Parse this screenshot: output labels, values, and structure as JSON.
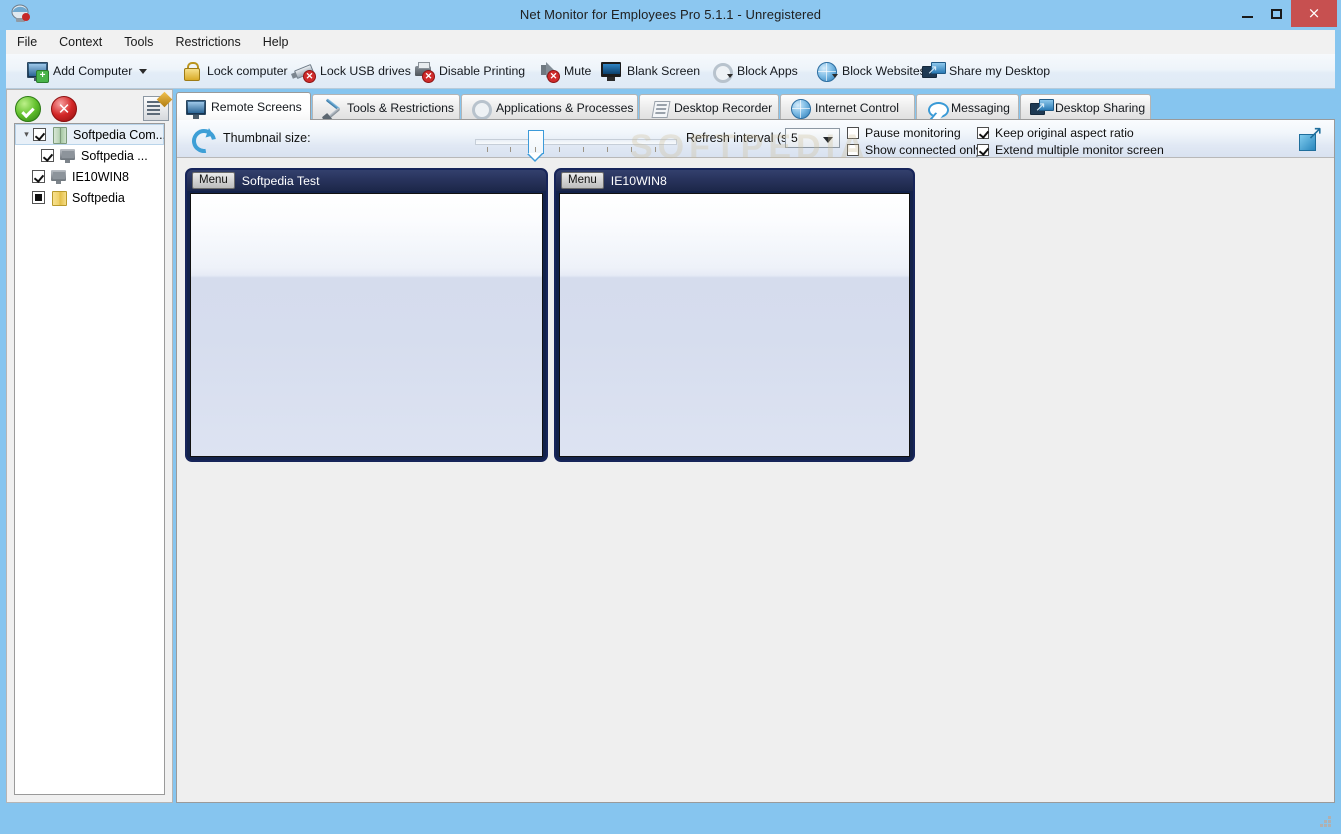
{
  "window": {
    "title": "Net Monitor for Employees Pro 5.1.1 - Unregistered",
    "app_icon": "net-monitor-icon",
    "minimize_label": "",
    "maximize_label": "",
    "close_label": "×",
    "accent_titlebar": "#8cc7f0",
    "accent_close": "#c75050"
  },
  "menubar": {
    "items": [
      {
        "label": "File"
      },
      {
        "label": "Context"
      },
      {
        "label": "Tools"
      },
      {
        "label": "Restrictions"
      },
      {
        "label": "Help"
      }
    ]
  },
  "toolbar": {
    "items": [
      {
        "label": "Add Computer",
        "icon": "monitor-plus-icon",
        "has_dropdown": true
      },
      {
        "label": "Lock computer",
        "icon": "padlock-icon",
        "has_dropdown": false
      },
      {
        "label": "Lock USB drives",
        "icon": "usb-blocked-icon",
        "has_dropdown": false
      },
      {
        "label": "Disable Printing",
        "icon": "printer-blocked-icon",
        "has_dropdown": false
      },
      {
        "label": "Mute",
        "icon": "speaker-muted-icon",
        "has_dropdown": false
      },
      {
        "label": "Blank Screen",
        "icon": "blank-monitor-icon",
        "has_dropdown": false
      },
      {
        "label": "Block Apps",
        "icon": "gear-icon",
        "has_dropdown": true
      },
      {
        "label": "Block Websites",
        "icon": "globe-icon",
        "has_dropdown": true
      },
      {
        "label": "Share my Desktop",
        "icon": "share-desktop-icon",
        "has_dropdown": false
      }
    ]
  },
  "sidebar": {
    "approve_button": "approve-icon",
    "reject_button": "reject-icon",
    "note_button": "note-edit-icon",
    "tree": [
      {
        "label": "Softpedia Com...",
        "icon": "server-icon",
        "checkbox": "checked",
        "expander": "expanded",
        "indent": 0,
        "selected": true
      },
      {
        "label": "Softpedia ...",
        "icon": "monitor-icon",
        "checkbox": "checked",
        "expander": "none",
        "indent": 1,
        "selected": false
      },
      {
        "label": "IE10WIN8",
        "icon": "monitor-icon",
        "checkbox": "checked",
        "expander": "none",
        "indent": 0,
        "selected": false
      },
      {
        "label": "Softpedia",
        "icon": "folder-icon",
        "checkbox": "partial",
        "expander": "none",
        "indent": 0,
        "selected": false
      }
    ]
  },
  "tabs": [
    {
      "label": "Remote Screens",
      "icon": "monitor-icon",
      "active": true
    },
    {
      "label": "Tools & Restrictions",
      "icon": "tools-icon",
      "active": false
    },
    {
      "label": "Applications & Processes",
      "icon": "gear-icon",
      "active": false
    },
    {
      "label": "Desktop Recorder",
      "icon": "film-icon",
      "active": false
    },
    {
      "label": "Internet Control",
      "icon": "globe-icon",
      "active": false
    },
    {
      "label": "Messaging",
      "icon": "chat-bubble-icon",
      "active": false
    },
    {
      "label": "Desktop Sharing",
      "icon": "share-desktop-icon",
      "active": false
    }
  ],
  "options": {
    "refresh_icon": "refresh-icon",
    "thumbnail_size_label": "Thumbnail size:",
    "thumbnail_slider_value": 26,
    "refresh_interval_label": "Refresh interval (s):",
    "refresh_interval_value": "5",
    "checkboxes": [
      {
        "label": "Pause monitoring",
        "checked": false
      },
      {
        "label": "Show connected only",
        "checked": false
      },
      {
        "label": "Keep original aspect ratio",
        "checked": true
      },
      {
        "label": "Extend multiple monitor screen",
        "checked": true
      }
    ],
    "expand_button": "expand-arrow-icon"
  },
  "watermark": {
    "text": "SOFTPEDIA"
  },
  "thumbnails": [
    {
      "menu_label": "Menu",
      "title": "Softpedia Test"
    },
    {
      "menu_label": "Menu",
      "title": "IE10WIN8"
    }
  ]
}
